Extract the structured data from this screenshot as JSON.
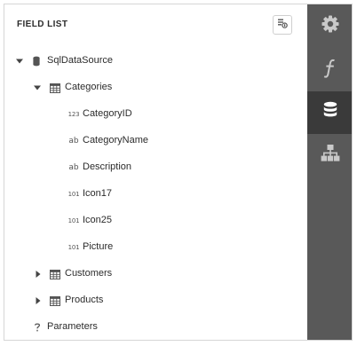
{
  "header": {
    "title": "FIELD LIST",
    "action_icon": "add-calculated-field-icon"
  },
  "tree": {
    "datasource": {
      "label": "SqlDataSource",
      "expanded": true,
      "icon": "database-icon"
    },
    "categories": {
      "label": "Categories",
      "expanded": true,
      "icon": "table-icon"
    },
    "fields": [
      {
        "label": "CategoryID",
        "type_badge": "123"
      },
      {
        "label": "CategoryName",
        "type_badge": "ab"
      },
      {
        "label": "Description",
        "type_badge": "ab"
      },
      {
        "label": "Icon17",
        "type_badge": "101"
      },
      {
        "label": "Icon25",
        "type_badge": "101"
      },
      {
        "label": "Picture",
        "type_badge": "101"
      }
    ],
    "customers": {
      "label": "Customers",
      "expanded": false,
      "icon": "table-icon"
    },
    "products": {
      "label": "Products",
      "expanded": false,
      "icon": "table-icon"
    },
    "parameters": {
      "label": "Parameters",
      "icon": "parameters-icon"
    }
  },
  "sidebar": {
    "tabs": [
      {
        "name": "properties",
        "icon": "gear-icon",
        "active": false
      },
      {
        "name": "expressions",
        "icon": "function-icon",
        "active": false
      },
      {
        "name": "field-list",
        "icon": "database-icon",
        "active": true
      },
      {
        "name": "report-explorer",
        "icon": "hierarchy-icon",
        "active": false
      }
    ]
  },
  "colors": {
    "sidebar_bg": "#595959",
    "sidebar_active": "#3a3a3a",
    "sidebar_icon": "#c9c9c9",
    "sidebar_icon_active": "#ffffff"
  }
}
